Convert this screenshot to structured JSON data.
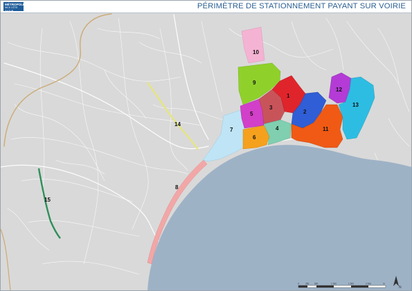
{
  "header": {
    "title": "PÉRIMÈTRE DE STATIONNEMENT PAYANT SUR VOIRIE",
    "logo_line1": "MÉTROPOLE",
    "logo_line2": "NICE CÔTE D'AZUR"
  },
  "zones": [
    {
      "label": "10",
      "color": "#f4b3d3"
    },
    {
      "label": "9",
      "color": "#8fd12a"
    },
    {
      "label": "5",
      "color": "#d23fc8"
    },
    {
      "label": "3",
      "color": "#c8545a"
    },
    {
      "label": "1",
      "color": "#e0242c"
    },
    {
      "label": "2",
      "color": "#2f5ed6"
    },
    {
      "label": "7",
      "color": "#bfe4f5"
    },
    {
      "label": "6",
      "color": "#f5a11d"
    },
    {
      "label": "4",
      "color": "#7fcfb0"
    },
    {
      "label": "11",
      "color": "#f05a14"
    },
    {
      "label": "12",
      "color": "#b43bd6"
    },
    {
      "label": "13",
      "color": "#2dbde3"
    },
    {
      "label": "14",
      "color": "#e6e67a"
    },
    {
      "label": "8",
      "color": "#f2a7a7"
    },
    {
      "label": "15",
      "color": "#2f8f5a"
    }
  ],
  "scale_ticks": [
    "0",
    "250",
    "500",
    "1 000",
    "1 500",
    "2 000"
  ],
  "scale_unit": "m",
  "north_label": "N",
  "colors": {
    "sea": "#9eb2c6",
    "land": "#d9d9d9",
    "roads": "#ffffff",
    "title": "#2b5f93"
  }
}
